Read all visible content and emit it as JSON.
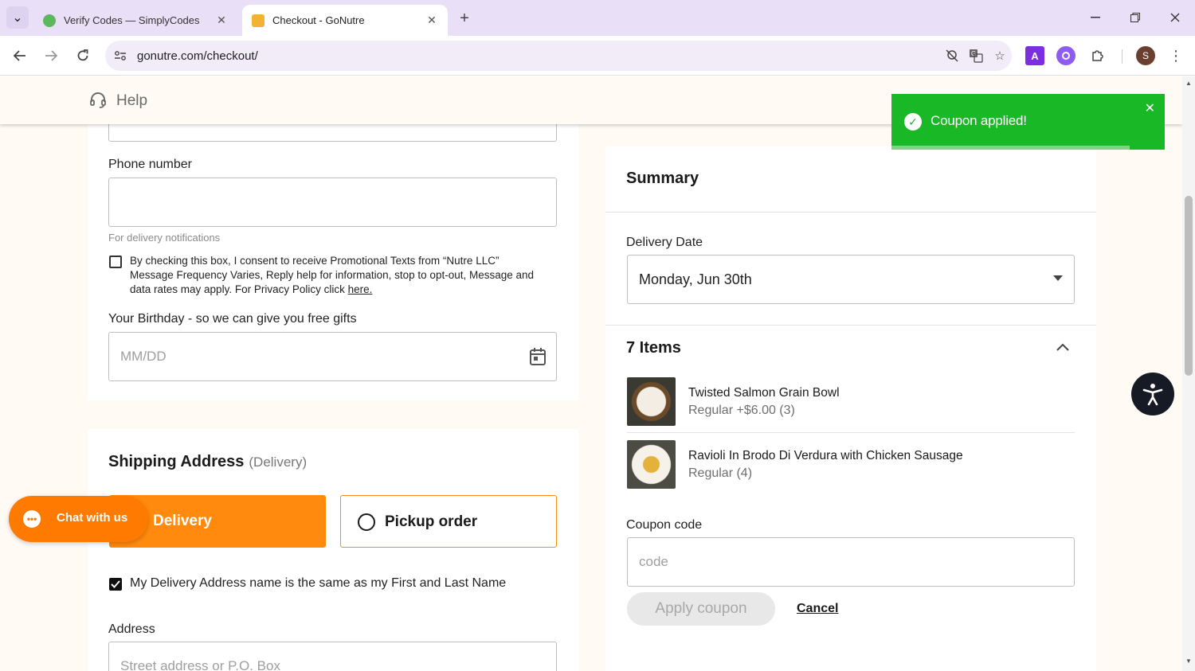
{
  "browser": {
    "tabs": [
      {
        "title": "Verify Codes — SimplyCodes",
        "close": "✕"
      },
      {
        "title": "Checkout - GoNutre",
        "close": "✕"
      }
    ],
    "new_tab": "+",
    "url": "gonutre.com/checkout/",
    "profile_initial": "S",
    "ext_a": "A"
  },
  "header": {
    "help_label": "Help"
  },
  "toast": {
    "message": "Coupon applied!",
    "close": "✕"
  },
  "contact": {
    "phone_label": "Phone number",
    "phone_value": "",
    "phone_hint": "For delivery notifications",
    "consent_text": "By checking this box, I consent to receive Promotional Texts from “Nutre LLC” Message Frequency Varies, Reply help for information, stop to opt-out, Message and data rates may apply. For Privacy Policy click ",
    "consent_link": "here.",
    "consent_checked": false,
    "birthday_label": "Your Birthday - so we can give you free gifts",
    "birthday_placeholder": "MM/DD"
  },
  "shipping": {
    "title": "Shipping Address",
    "subtitle": "(Delivery)",
    "option_delivery": "Delivery",
    "option_pickup": "Pickup order",
    "same_name_label": "My Delivery Address name is the same as my First and Last Name",
    "same_name_checked": true,
    "address_label": "Address",
    "address_placeholder": "Street address or P.O. Box"
  },
  "chat": {
    "label": "Chat with us"
  },
  "summary": {
    "title": "Summary",
    "delivery_date_label": "Delivery Date",
    "delivery_date_value": "Monday, Jun 30th",
    "items_title": "7 Items",
    "items": [
      {
        "name": "Twisted Salmon Grain Bowl",
        "variant": "Regular +$6.00 (3)"
      },
      {
        "name": "Ravioli In Brodo Di Verdura with Chicken Sausage",
        "variant": "Regular (4)"
      }
    ],
    "coupon_label": "Coupon code",
    "coupon_placeholder": "code",
    "apply_label": "Apply coupon",
    "cancel_label": "Cancel"
  },
  "colors": {
    "accent_orange": "#ff8a0d",
    "toast_green": "#18b826",
    "page_bg": "#fffaf3"
  }
}
